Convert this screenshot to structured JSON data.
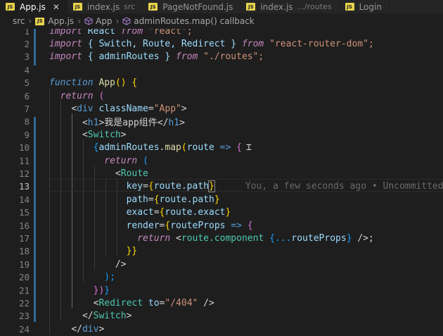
{
  "tabs": [
    {
      "label": "App.js",
      "active": true,
      "close": "✕"
    },
    {
      "label": "index.js",
      "desc": "src"
    },
    {
      "label": "PageNotFound.js"
    },
    {
      "label": "index.js",
      "desc": ".../routes"
    },
    {
      "label": "Login"
    }
  ],
  "breadcrumb": {
    "folder": "src",
    "file": "App.js",
    "symbol1": "App",
    "symbol2": "adminRoutes.map() callback"
  },
  "icons": {
    "js": "JS",
    "cube": "symbol-cube-icon"
  },
  "colors": {
    "accent": "#569cd6",
    "keyword": "#c586c0",
    "string": "#ce9178",
    "component": "#4ec9b0"
  },
  "editor": {
    "line_numbers": [
      "1",
      "2",
      "3",
      "4",
      "5",
      "6",
      "7",
      "8",
      "9",
      "10",
      "11",
      "12",
      "13",
      "14",
      "15",
      "16",
      "17",
      "18",
      "19",
      "20",
      "21",
      "22",
      "23",
      "24"
    ],
    "blame": "You, a few seconds ago • Uncommitted cha",
    "lines": {
      "l1": {
        "kw": "import",
        "a": " React ",
        "kw2": "from",
        "s": " \"react\";"
      },
      "l2": {
        "kw": "import",
        "a": " { Switch, Route, Redirect } ",
        "kw2": "from",
        "s": " \"react-router-dom\";"
      },
      "l3": {
        "kw": "import",
        "a": " { adminRoutes } ",
        "kw2": "from",
        "s": " \"./routes\";"
      },
      "l5": {
        "kw": "function",
        "fn": " App",
        "b": "() {"
      },
      "l6": {
        "kw": "return",
        "b": " ("
      },
      "l7": {
        "lt": "<",
        "tag": "div",
        "attr": " className",
        "eq": "=",
        "s": "\"App\"",
        "gt": ">"
      },
      "l8": {
        "lt": "<",
        "tag": "h1",
        "gt": ">",
        "t": "我是app组件",
        "clt": "</",
        "ctag": "h1",
        "cgt": ">"
      },
      "l9": {
        "lt": "<",
        "tag": "Switch",
        "gt": ">"
      },
      "l10": {
        "o": "{",
        "v": "adminRoutes",
        "d": ".",
        "fn": "map",
        "p": "(",
        "v2": "route",
        "ar": " => ",
        "c": "{"
      },
      "l11": {
        "kw": "return",
        "b": " ("
      },
      "l12": {
        "lt": "<",
        "tag": "Route"
      },
      "l13": {
        "attr": "key",
        "eq": "=",
        "o": "{",
        "v": "route.path",
        "c": "}"
      },
      "l14": {
        "attr": "path",
        "eq": "=",
        "o": "{",
        "v": "route.path",
        "c": "}"
      },
      "l15": {
        "attr": "exact",
        "eq": "=",
        "o": "{",
        "v": "route.exact",
        "c": "}"
      },
      "l16": {
        "attr": "render",
        "eq": "=",
        "o": "{",
        "v": "routeProps",
        "ar": " => ",
        "c": "{"
      },
      "l17": {
        "kw": "return",
        "lt": " <",
        "tag": "route.component",
        "a": " {...",
        "v": "routeProps",
        "b": "}",
        "end": " />;"
      },
      "l18": {
        "c": "}}"
      },
      "l19": {
        "t": "/>"
      },
      "l20": {
        "t": ");"
      },
      "l21": {
        "a": "})",
        "c": "}"
      },
      "l22": {
        "lt": "<",
        "tag": "Redirect",
        "attr": " to",
        "eq": "=",
        "s": "\"/404\"",
        "end": " />"
      },
      "l23": {
        "lt": "</",
        "tag": "Switch",
        "gt": ">"
      },
      "l24": {
        "lt": "</",
        "tag": "div",
        "gt": ">"
      }
    }
  }
}
